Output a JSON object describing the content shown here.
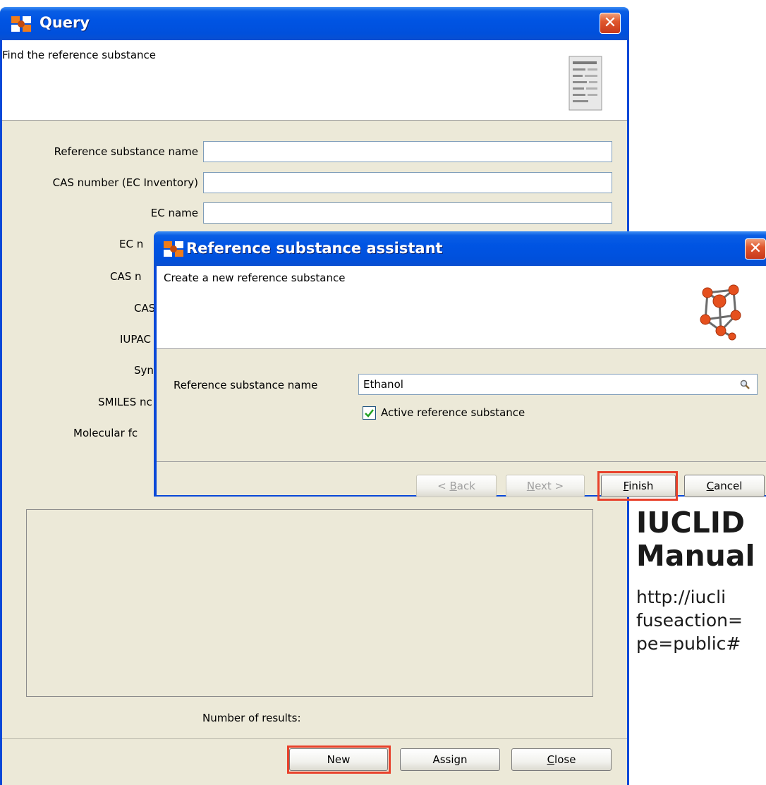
{
  "query_window": {
    "title": "Query",
    "header_text": "Find the reference substance",
    "labels": {
      "ref_name": "Reference substance name",
      "cas_ec": "CAS number (EC Inventory)",
      "ec_name": "EC name",
      "ec_num_partial": "EC n",
      "cas_num_partial": "CAS n",
      "cas_partial": "CAS",
      "iupac_partial": "IUPAC",
      "syn_partial": "Syn",
      "smiles_partial": "SMILES nc",
      "molecular_partial": "Molecular fc"
    },
    "results_label": "Number of results:",
    "buttons": {
      "new": "New",
      "assign": "Assign",
      "close_prefix": "C",
      "close_rest": "lose"
    }
  },
  "assistant_window": {
    "title": "Reference substance assistant",
    "header_text": "Create a new reference substance",
    "field_label": "Reference substance name",
    "field_value": "Ethanol",
    "checkbox_label": "Active reference substance",
    "checkbox_checked": true,
    "buttons": {
      "back_pre": "< ",
      "back_ul": "B",
      "back_post": "ack",
      "next_ul": "N",
      "next_post": "ext >",
      "finish_ul": "F",
      "finish_post": "inish",
      "cancel_ul": "C",
      "cancel_post": "ancel"
    }
  },
  "side_text": {
    "heading_line1": "IUCLID",
    "heading_line2": "Manual",
    "url_line1": "http://iucli",
    "url_line2": "fuseaction=",
    "url_line3": "pe=public#"
  },
  "colors": {
    "titlebar": "#0054e3",
    "highlight": "#e8412b",
    "dialog_body": "#ece9d8"
  },
  "icons": [
    "app-logo-icon",
    "close-icon",
    "document-list-icon",
    "molecule-icon",
    "magnifier-icon",
    "checkmark-icon"
  ]
}
